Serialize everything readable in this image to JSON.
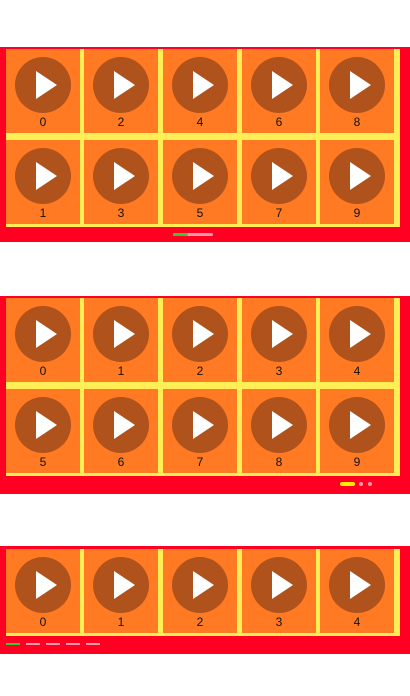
{
  "carousels": [
    {
      "labels": [
        "0",
        "2",
        "4",
        "6",
        "8",
        "1",
        "3",
        "5",
        "7",
        "9"
      ],
      "indicator": "progress-bar",
      "progress": 0.38
    },
    {
      "labels": [
        "0",
        "1",
        "2",
        "3",
        "4",
        "5",
        "6",
        "7",
        "8",
        "9"
      ],
      "indicator": "page-dots",
      "pages": 3,
      "active_page": 1
    },
    {
      "labels": [
        "0",
        "1",
        "2",
        "3",
        "4"
      ],
      "indicator": "segments",
      "segments": 5,
      "active_segment": 1
    }
  ],
  "tile_icon": "play-icon",
  "colors": {
    "panel": "#ff0022",
    "grid_lines": "#ffee55",
    "tile": "#ff7a22",
    "play_circle": "#b0521b",
    "indicator_active_green": "#33cc33",
    "indicator_active_yellow": "#ffee00",
    "indicator_inactive": "#ff9aa6"
  }
}
